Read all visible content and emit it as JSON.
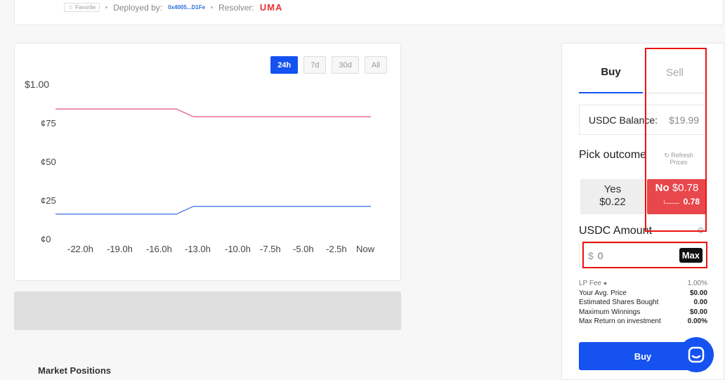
{
  "header": {
    "favorite_label": "Favorite",
    "deployed_label": "Deployed by:",
    "deployer_address": "0x4005...D1Fe",
    "resolver_label": "Resolver:",
    "resolver_name": "UMA"
  },
  "chart": {
    "ranges": [
      "24h",
      "7d",
      "30d",
      "All"
    ],
    "active_range": "24h"
  },
  "chart_data": {
    "type": "line",
    "title": "",
    "xlabel": "",
    "ylabel": "",
    "x_tick_labels": [
      "-22.0h",
      "-19.0h",
      "-16.0h",
      "-13.0h",
      "-10.0h",
      "-7.5h",
      "-5.0h",
      "-2.5h",
      "Now"
    ],
    "y_tick_labels": [
      "$1.00",
      "¢75",
      "¢50",
      "¢25",
      "¢0"
    ],
    "ylim": [
      0,
      1
    ],
    "x": [
      -24,
      -16,
      -14.8,
      -13.5,
      0
    ],
    "series": [
      {
        "values": [
          0.84,
          0.84,
          0.84,
          0.79,
          0.79
        ],
        "color": "#e8608a"
      },
      {
        "values": [
          0.16,
          0.16,
          0.16,
          0.21,
          0.21
        ],
        "color": "#4a7be8"
      }
    ],
    "grid": false,
    "legend": "none"
  },
  "positions": {
    "title": "Market Positions"
  },
  "trade": {
    "tabs": [
      "Buy",
      "Sell"
    ],
    "active_tab": "Buy",
    "balance_label": "USDC Balance:",
    "balance_value": "$19.99",
    "pick_label": "Pick outcome",
    "refresh_label": "Refresh Prices",
    "outcomes": [
      {
        "name": "Yes",
        "price": "$0.22"
      },
      {
        "name": "No",
        "price": "$0.78",
        "shares": "0.78"
      }
    ],
    "amount_label": "USDC Amount",
    "currency_symbol": "$",
    "amount_placeholder": "0",
    "max_label": "Max",
    "stats": [
      {
        "label": "LP Fee",
        "value": "1.00%"
      },
      {
        "label": "Your Avg. Price",
        "value": "$0.00"
      },
      {
        "label": "Estimated Shares Bought",
        "value": "0.00"
      },
      {
        "label": "Maximum Winnings",
        "value": "$0.00"
      },
      {
        "label": "Max Return on investment",
        "value": "0.00%"
      }
    ],
    "buy_button": "Buy"
  },
  "colors": {
    "accent": "#1652f0",
    "no_outcome": "#e8474b",
    "highlight": "#e11111"
  }
}
